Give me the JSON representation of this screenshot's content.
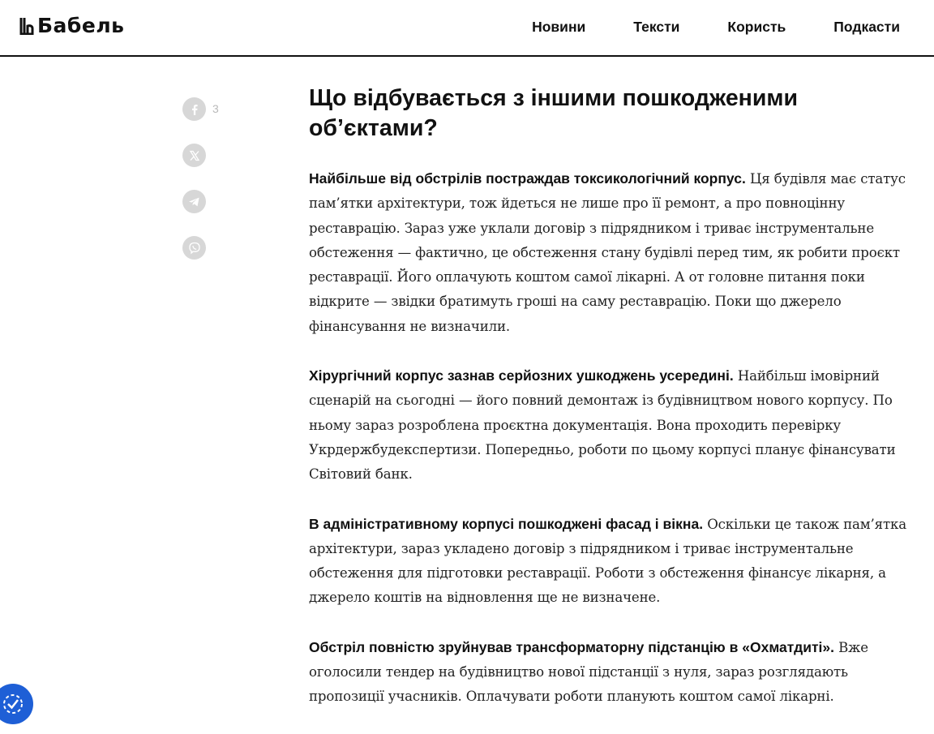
{
  "site": {
    "logo_text": "Бабель"
  },
  "nav": {
    "items": [
      {
        "label": "Новини"
      },
      {
        "label": "Тексти"
      },
      {
        "label": "Користь"
      },
      {
        "label": "Подкасти"
      }
    ]
  },
  "share": {
    "facebook_count": "3",
    "icons": [
      "facebook-icon",
      "x-icon",
      "telegram-icon",
      "viber-icon"
    ]
  },
  "article": {
    "heading": "Що відбувається з іншими пошкодженими об’єктами?",
    "paragraphs": [
      {
        "lead": "Найбільше від обстрілів постраждав токсикологічний корпус.",
        "text": " Ця будівля має статус пам’ятки архітектури, тож йдеться не лише про її ремонт, а про повноцінну реставрацію. Зараз уже уклали договір з підрядником і триває інструментальне обстеження — фактично, це обстеження стану будівлі перед тим, як робити проєкт реставрації. Його оплачують коштом самої лікарні. А от головне питання поки відкрите — звідки братимуть гроші на саму реставрацію. Поки що джерело фінансування не визначили."
      },
      {
        "lead": "Хірургічний корпус зазнав серйозних ушкоджень усередині.",
        "text": " Найбільш імовірний сценарій на сьогодні — його повний демонтаж із будівництвом нового корпусу. По ньому зараз розроблена проєктна документація. Вона проходить перевірку Укрдержбудекспертизи. Попередньо, роботи по цьому корпусі планує фінансувати Світовий банк."
      },
      {
        "lead": "В адміністративному корпусі пошкоджені фасад і вікна.",
        "text": " Оскільки це також пам’ятка архітектури, зараз укладено договір з підрядником і триває інструментальне обстеження для підготовки реставрації. Роботи з обстеження фінансує лікарня, а джерело коштів на відновлення ще не визначене."
      },
      {
        "lead": "Обстріл повністю зруйнував трансформаторну підстанцію в «Охматдиті».",
        "text": " Вже оголосили тендер на будівництво нової підстанції з нуля, зараз розглядають пропозиції учасників. Оплачувати роботи планують коштом самої лікарні."
      }
    ]
  },
  "colors": {
    "text": "#111111",
    "share_button": "#d7d7d7",
    "accessibility_button": "#1e5fd6"
  }
}
